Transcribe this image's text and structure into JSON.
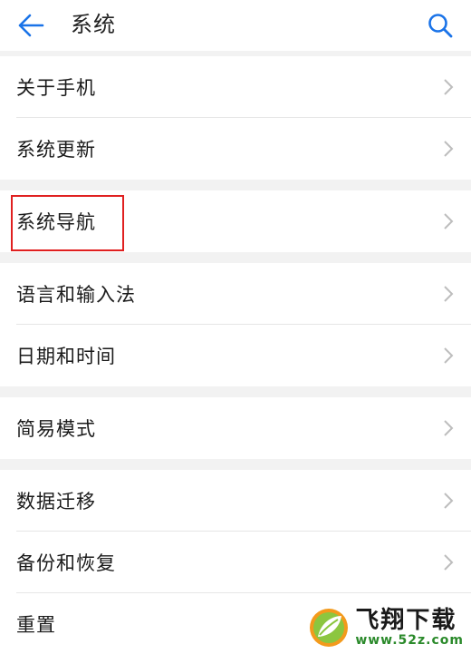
{
  "header": {
    "title": "系统",
    "back_icon": "arrow-left-icon",
    "search_icon": "search-icon",
    "accent_color": "#1a73e8"
  },
  "groups": [
    {
      "items": [
        {
          "label": "关于手机"
        },
        {
          "label": "系统更新"
        }
      ]
    },
    {
      "items": [
        {
          "label": "系统导航"
        }
      ]
    },
    {
      "items": [
        {
          "label": "语言和输入法"
        },
        {
          "label": "日期和时间"
        }
      ]
    },
    {
      "items": [
        {
          "label": "简易模式"
        }
      ]
    },
    {
      "items": [
        {
          "label": "数据迁移"
        },
        {
          "label": "备份和恢复"
        },
        {
          "label": "重置"
        }
      ]
    }
  ],
  "highlight": {
    "color": "#e02020",
    "target": "系统导航"
  },
  "watermark": {
    "title": "飞翔下载",
    "url": "www.52z.com",
    "logo_icon": "leaf-logo-icon"
  }
}
